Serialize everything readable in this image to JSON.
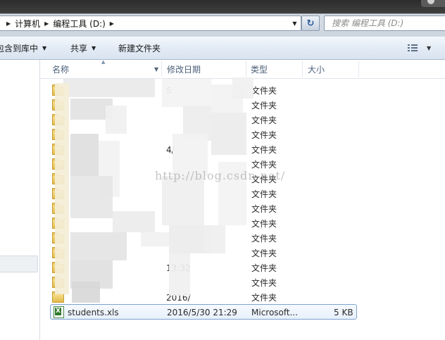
{
  "address_bar": {
    "crumbs": [
      "计算机",
      "编程工具 (D:)"
    ]
  },
  "search": {
    "placeholder": "搜索 编程工具 (D:)"
  },
  "toolbar": {
    "include_in_library": "包含到库中",
    "share": "共享",
    "new_folder": "新建文件夹"
  },
  "columns": {
    "name": "名称",
    "date_modified": "修改日期",
    "type": "类型",
    "size": "大小"
  },
  "folder_rows": [
    {
      "date": "5",
      "type": "文件夹"
    },
    {
      "date": "",
      "type": "文件夹"
    },
    {
      "date": "",
      "type": "文件夹"
    },
    {
      "date": "",
      "type": "文件夹"
    },
    {
      "date": "4/",
      "type": "文件夹"
    },
    {
      "date": "",
      "type": "文件夹"
    },
    {
      "date": "",
      "type": "文件夹"
    },
    {
      "date": "",
      "type": "文件夹"
    },
    {
      "date": "",
      "type": "文件夹"
    },
    {
      "date": "",
      "type": "文件夹"
    },
    {
      "date": "",
      "type": "文件夹"
    },
    {
      "date": "",
      "type": "文件夹"
    },
    {
      "date": "13:32",
      "type": "文件夹"
    },
    {
      "date": "",
      "type": "文件夹"
    },
    {
      "date": "2016/",
      "type": "文件夹"
    }
  ],
  "file_row": {
    "name": "students.xls",
    "date": "2016/5/30 21:29",
    "type": "Microsoft...",
    "size": "5 KB"
  },
  "watermark": "http://blog.csdn.net/",
  "colors": {
    "selection_border": "#7da2ce",
    "folder_yellow": "#e3bb4c",
    "header_text": "#4c607a"
  }
}
